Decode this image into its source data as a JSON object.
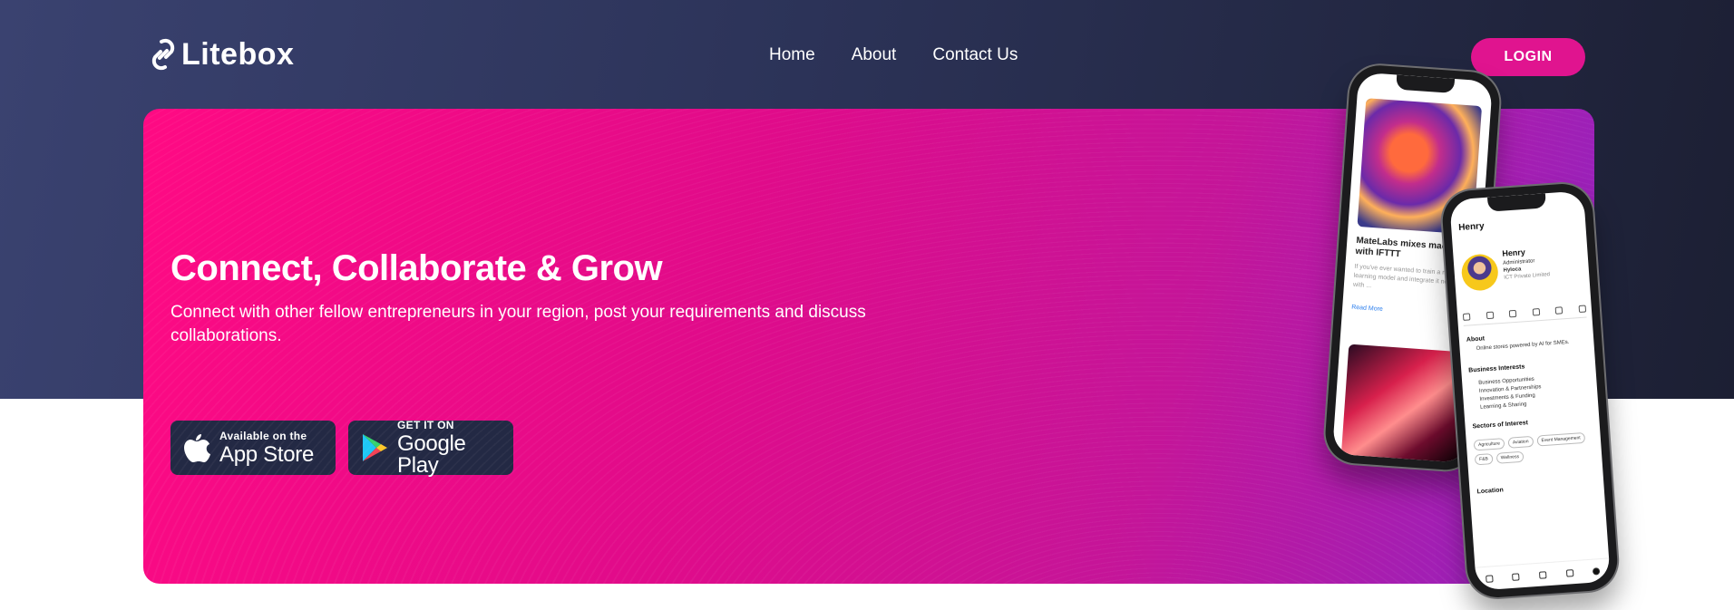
{
  "brand": {
    "name": "Litebox",
    "accent": "#e0148f"
  },
  "nav": {
    "items": [
      {
        "label": "Home"
      },
      {
        "label": "About"
      },
      {
        "label": "Contact Us"
      }
    ],
    "login_label": "LOGIN"
  },
  "hero": {
    "title": "Connect, Collaborate & Grow",
    "subtitle": "Connect with other fellow entrepreneurs in your region, post your requirements and discuss collaborations.",
    "app_store": {
      "small": "Available on the",
      "big": "App Store",
      "icon": "apple-icon"
    },
    "google_play": {
      "small": "GET IT ON",
      "big": "Google Play",
      "icon": "google-play-icon"
    }
  },
  "phone_back": {
    "post_title": "MateLabs mixes machine with IFTTT",
    "post_body": "If you've ever wanted to train a machine learning model and integrate it now can with ...",
    "read_more": "Read More"
  },
  "phone_front": {
    "header": "Henry",
    "name": "Henry",
    "role": "Administrator",
    "company": "Hyloca",
    "company_type": "ICT Private Limited",
    "about_heading": "About",
    "about_text": "Online stores powered by AI for SMEs.",
    "interests_heading": "Business Interests",
    "interests": [
      "Business Opportunities",
      "Innovation & Partnerships",
      "Investments & Funding",
      "Learning & Sharing"
    ],
    "sectors_heading": "Sectors of Interest",
    "sectors": [
      "Agriculture",
      "Aviation",
      "Event Management",
      "F&B",
      "Wellness"
    ],
    "location_heading": "Location"
  }
}
